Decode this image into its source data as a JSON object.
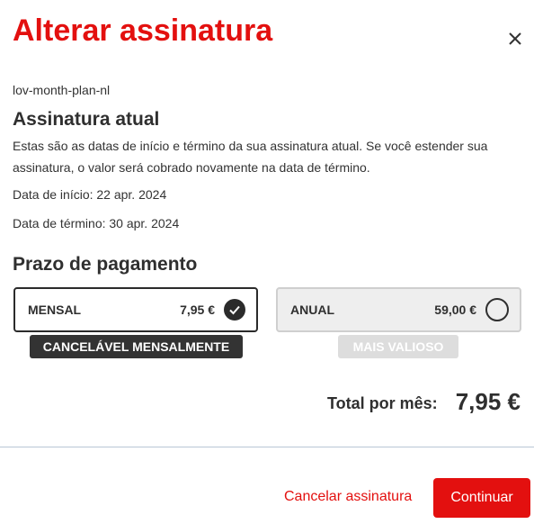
{
  "dialog": {
    "title": "Alterar assinatura",
    "close_icon": "close-icon"
  },
  "subscription": {
    "plan_id": "lov-month-plan-nl",
    "heading": "Assinatura atual",
    "description": "Estas são as datas de início e término da sua assinatura atual. Se você estender sua assinatura, o valor será cobrado novamente na data de término.",
    "start_date": "Data de início: 22 apr. 2024",
    "end_date": "Data de término: 30 apr. 2024"
  },
  "payment": {
    "heading": "Prazo de pagamento",
    "options": [
      {
        "name": "MENSAL",
        "price": "7,95 €",
        "selected": true,
        "badge": "CANCELÁVEL MENSALMENTE"
      },
      {
        "name": "ANUAL",
        "price": "59,00 €",
        "selected": false,
        "badge": "MAIS VALIOSO"
      }
    ]
  },
  "total": {
    "label": "Total por mês:",
    "value": "7,95 €"
  },
  "footer": {
    "cancel_label": "Cancelar assinatura",
    "continue_label": "Continuar"
  },
  "colors": {
    "brand_red": "#e3100f",
    "selected_border": "#2b2b2b",
    "unselected_bg": "#eeeeee"
  }
}
